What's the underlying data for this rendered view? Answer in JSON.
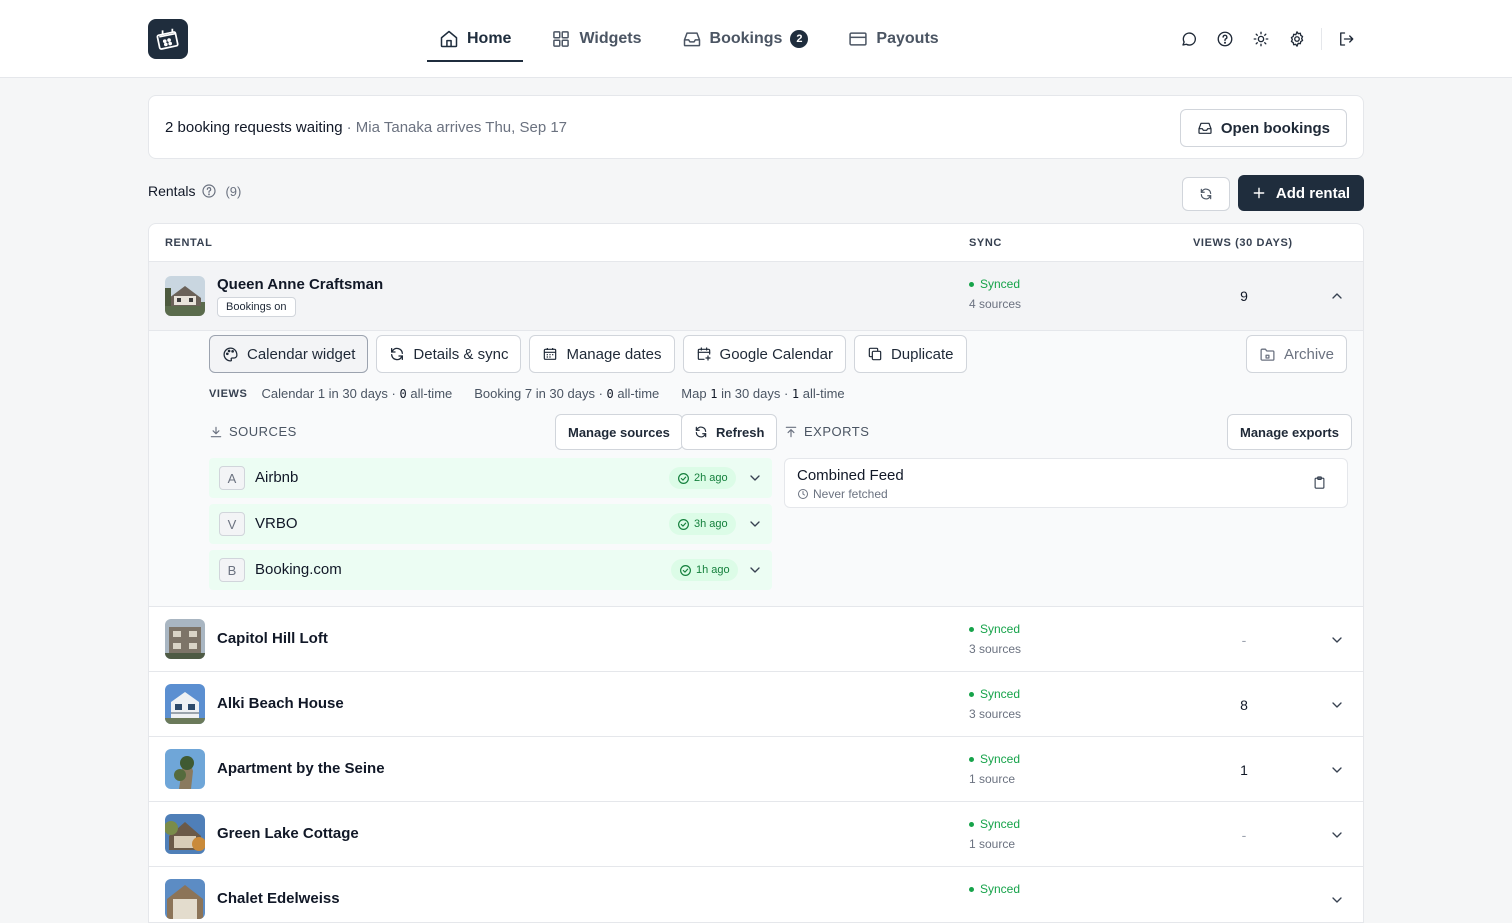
{
  "nav": {
    "items": [
      {
        "label": "Home",
        "icon": "home-icon",
        "active": true
      },
      {
        "label": "Widgets",
        "icon": "grid-icon"
      },
      {
        "label": "Bookings",
        "icon": "inbox-icon",
        "badge": "2"
      },
      {
        "label": "Payouts",
        "icon": "credit-card-icon"
      }
    ],
    "right_icons": [
      "chat-icon",
      "help-icon",
      "sun-icon",
      "gear-icon",
      "logout-icon"
    ]
  },
  "banner": {
    "strong": "2 booking requests waiting",
    "muted": "· Mia Tanaka arrives Thu, Sep 17",
    "button": "Open bookings"
  },
  "rentals": {
    "title": "Rentals",
    "count": "(9)",
    "add_label": "Add rental"
  },
  "table": {
    "headers": {
      "rental": "RENTAL",
      "sync": "SYNC",
      "views": "VIEWS (30 DAYS)"
    }
  },
  "expanded": {
    "name": "Queen Anne Craftsman",
    "pill": "Bookings on",
    "sync_status": "Synced",
    "sync_sources": "4 sources",
    "views": "9",
    "actions": {
      "calendar_widget": "Calendar widget",
      "details_sync": "Details & sync",
      "manage_dates": "Manage dates",
      "google_calendar": "Google Calendar",
      "duplicate": "Duplicate",
      "archive": "Archive"
    },
    "views_line": {
      "label": "VIEWS",
      "calendar_prefix": "Calendar 1 in 30 days ·",
      "calendar_alltime": "0",
      "booking_prefix": "Booking 7 in 30 days ·",
      "booking_alltime": "0",
      "alltime_suffix": "all-time",
      "map_prefix": "Map",
      "map_30": "1",
      "map_mid": "in 30 days ·",
      "map_alltime": "1"
    },
    "sources_label": "SOURCES",
    "manage_sources": "Manage sources",
    "refresh": "Refresh",
    "exports_label": "EXPORTS",
    "manage_exports": "Manage exports",
    "sources": [
      {
        "letter": "A",
        "name": "Airbnb",
        "badge": "2h ago"
      },
      {
        "letter": "V",
        "name": "VRBO",
        "badge": "3h ago"
      },
      {
        "letter": "B",
        "name": "Booking.com",
        "badge": "1h ago"
      }
    ],
    "export": {
      "title": "Combined Feed",
      "sub": "Never fetched"
    }
  },
  "rows": [
    {
      "name": "Capitol Hill Loft",
      "sync_status": "Synced",
      "sync_sources": "3 sources",
      "views": "-"
    },
    {
      "name": "Alki Beach House",
      "sync_status": "Synced",
      "sync_sources": "3 sources",
      "views": "8"
    },
    {
      "name": "Apartment by the Seine",
      "sync_status": "Synced",
      "sync_sources": "1 source",
      "views": "1"
    },
    {
      "name": "Green Lake Cottage",
      "sync_status": "Synced",
      "sync_sources": "1 source",
      "views": "-"
    },
    {
      "name": "Chalet Edelweiss",
      "sync_status": "Synced",
      "sync_sources": "",
      "views": ""
    }
  ],
  "colors": {
    "brand": "#1f2d3d",
    "synced": "#16a34a",
    "source_bg": "#ecfdf3"
  }
}
